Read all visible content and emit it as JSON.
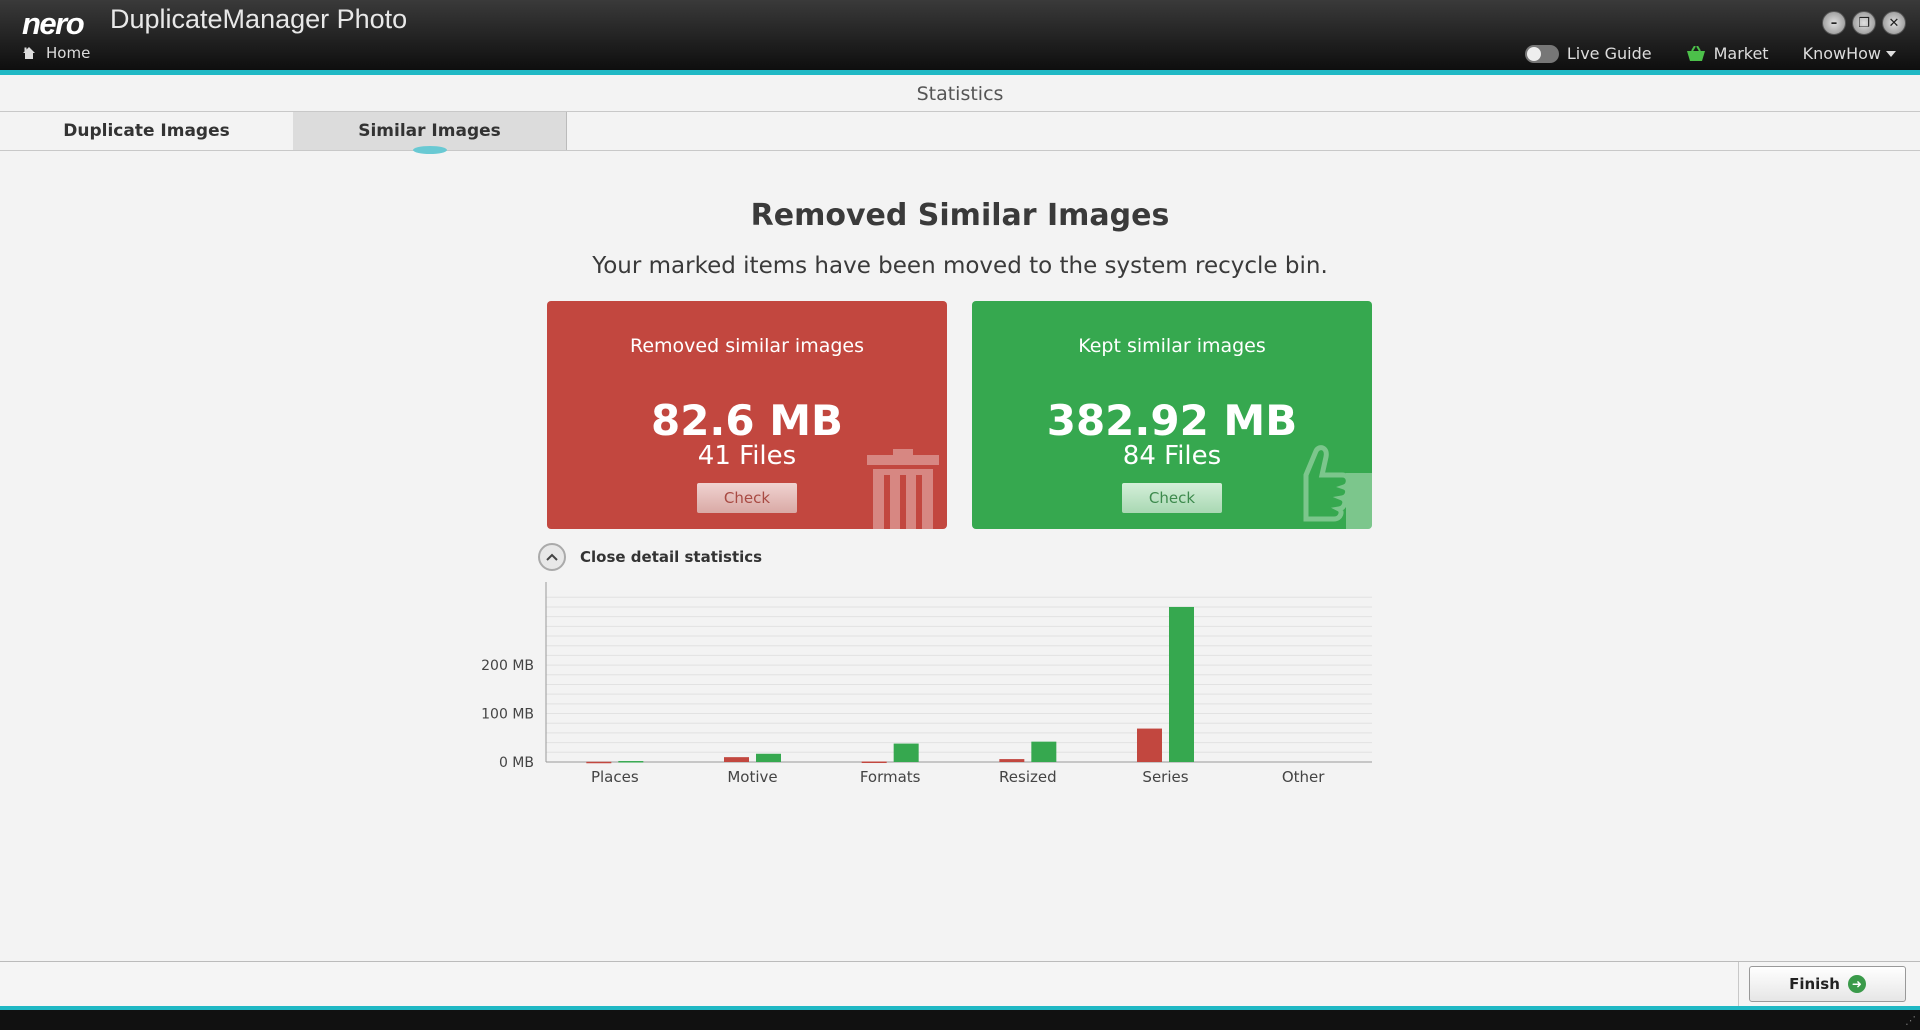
{
  "app": {
    "logo": "nero",
    "title": "DuplicateManager Photo",
    "home_label": "Home",
    "live_guide_label": "Live Guide",
    "market_label": "Market",
    "knowhow_label": "KnowHow"
  },
  "header": {
    "title": "Statistics"
  },
  "tabs": [
    {
      "label": "Duplicate Images",
      "active": false
    },
    {
      "label": "Similar Images",
      "active": true
    }
  ],
  "main": {
    "title": "Removed Similar Images",
    "subtitle": "Your marked items have been moved to the system recycle bin."
  },
  "cards": {
    "removed": {
      "title": "Removed similar images",
      "size": "82.6 MB",
      "files": "41 Files",
      "button": "Check",
      "color": "#c2473f",
      "icon": "trash-icon"
    },
    "kept": {
      "title": "Kept similar images",
      "size": "382.92 MB",
      "files": "84 Files",
      "button": "Check",
      "color": "#36a84f",
      "icon": "thumbs-up-icon"
    }
  },
  "detail": {
    "toggle_label": "Close detail statistics"
  },
  "chart_data": {
    "type": "bar",
    "categories": [
      "Places",
      "Motive",
      "Formats",
      "Resized",
      "Series",
      "Other"
    ],
    "series": [
      {
        "color": "#c2473f",
        "values": [
          0.5,
          10,
          1,
          6,
          69,
          0
        ]
      },
      {
        "color": "#36a84f",
        "values": [
          2,
          17,
          38,
          42,
          320,
          0
        ]
      }
    ],
    "ytick_values": [
      0,
      100,
      200
    ],
    "ytick_labels": [
      "0 MB",
      "100 MB",
      "200 MB"
    ],
    "ylim": [
      0,
      355
    ],
    "grid": true
  },
  "footer": {
    "finish_label": "Finish"
  }
}
